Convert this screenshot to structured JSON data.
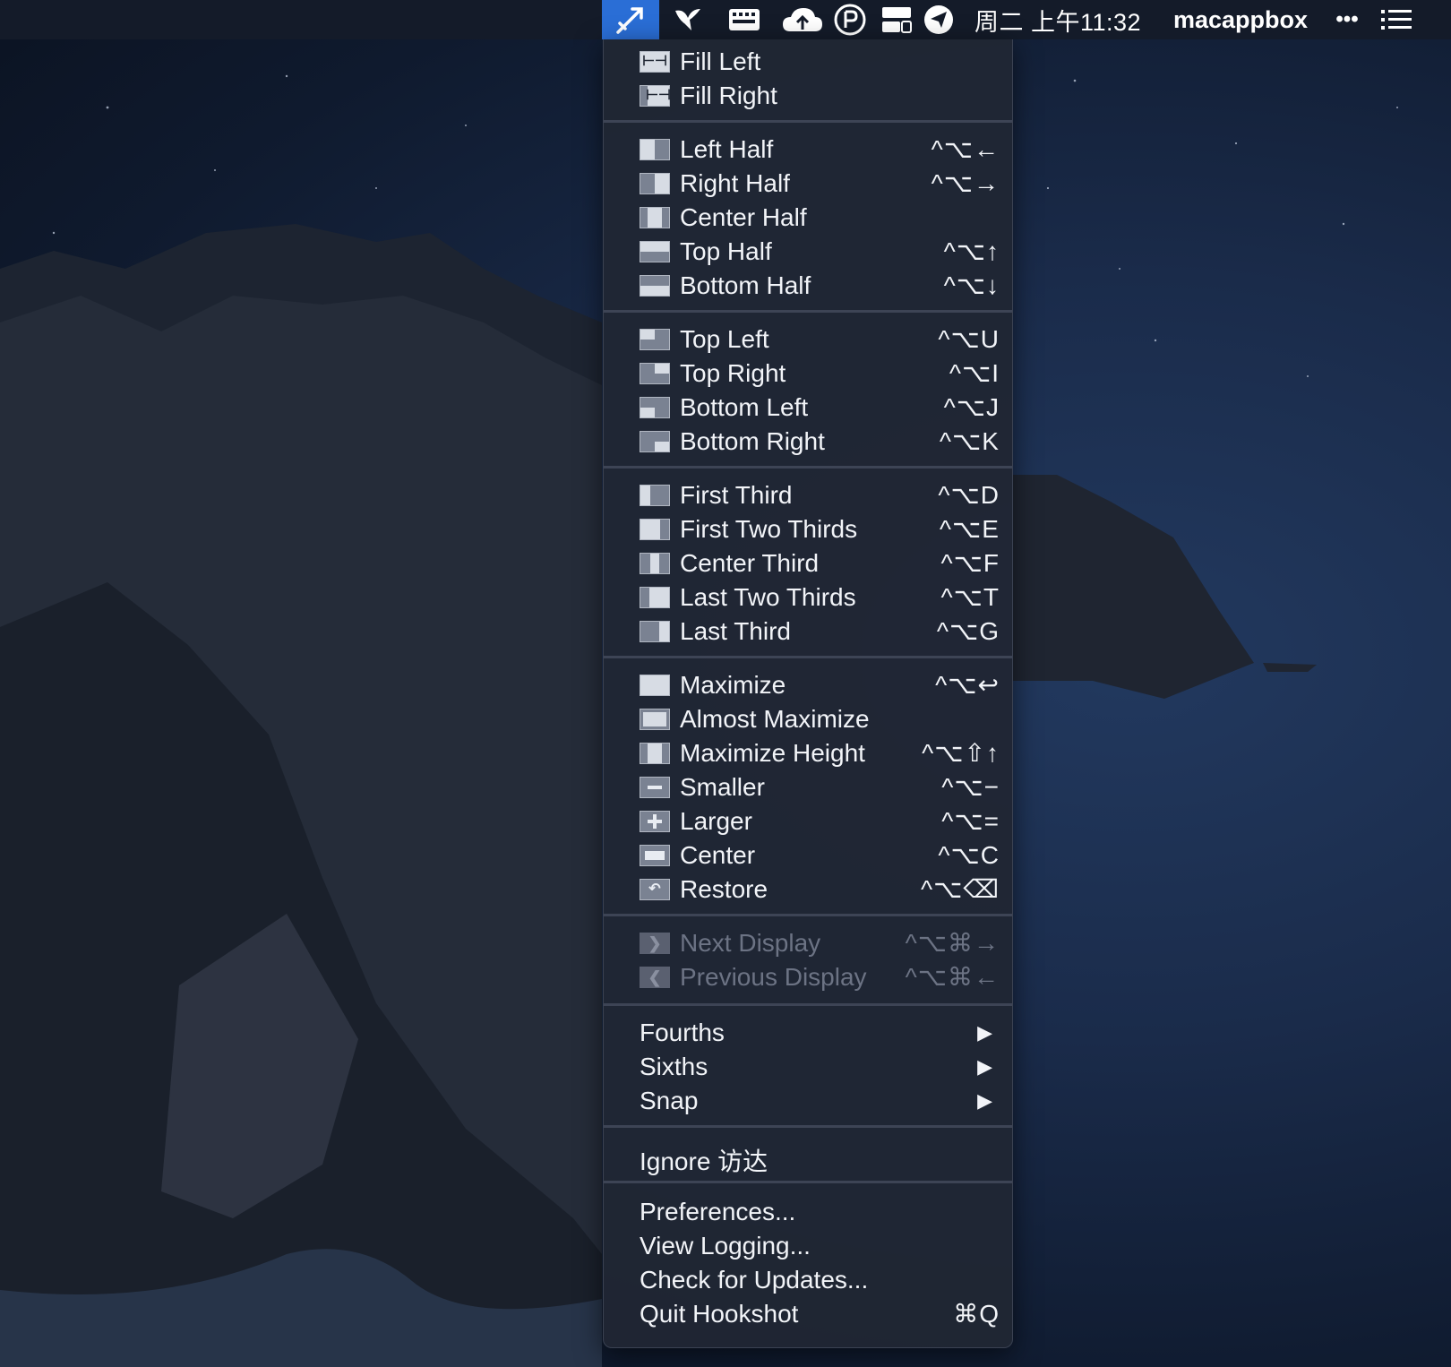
{
  "menubar": {
    "icons": [
      "hookshot-icon",
      "bird-icon",
      "keyboard-icon",
      "cloud-icon",
      "shield-badge-icon",
      "window-layout-icon",
      "paper-plane-icon"
    ],
    "clock": "周二 上午11:32",
    "user": "macappbox",
    "more": "•••",
    "list_icon": "notification-center-icon",
    "highlight_color": "#2a6ed6"
  },
  "menu": {
    "fill": [
      {
        "label": "Fill Left",
        "shortcut": ""
      },
      {
        "label": "Fill Right",
        "shortcut": ""
      }
    ],
    "halves": [
      {
        "label": "Left Half",
        "shortcut": "^⌥←"
      },
      {
        "label": "Right Half",
        "shortcut": "^⌥→"
      },
      {
        "label": "Center Half",
        "shortcut": ""
      },
      {
        "label": "Top Half",
        "shortcut": "^⌥↑"
      },
      {
        "label": "Bottom Half",
        "shortcut": "^⌥↓"
      }
    ],
    "corners": [
      {
        "label": "Top Left",
        "shortcut": "^⌥U"
      },
      {
        "label": "Top Right",
        "shortcut": "^⌥I"
      },
      {
        "label": "Bottom Left",
        "shortcut": "^⌥J"
      },
      {
        "label": "Bottom Right",
        "shortcut": "^⌥K"
      }
    ],
    "thirds": [
      {
        "label": "First Third",
        "shortcut": "^⌥D"
      },
      {
        "label": "First Two Thirds",
        "shortcut": "^⌥E"
      },
      {
        "label": "Center Third",
        "shortcut": "^⌥F"
      },
      {
        "label": "Last Two Thirds",
        "shortcut": "^⌥T"
      },
      {
        "label": "Last Third",
        "shortcut": "^⌥G"
      }
    ],
    "sizing": [
      {
        "label": "Maximize",
        "shortcut": "^⌥↩"
      },
      {
        "label": "Almost Maximize",
        "shortcut": ""
      },
      {
        "label": "Maximize Height",
        "shortcut": "^⌥⇧↑"
      },
      {
        "label": "Smaller",
        "shortcut": "^⌥−"
      },
      {
        "label": "Larger",
        "shortcut": "^⌥="
      },
      {
        "label": "Center",
        "shortcut": "^⌥C"
      },
      {
        "label": "Restore",
        "shortcut": "^⌥⌫"
      }
    ],
    "displays": [
      {
        "label": "Next Display",
        "shortcut": "^⌥⌘→"
      },
      {
        "label": "Previous Display",
        "shortcut": "^⌥⌘←"
      }
    ],
    "submenus": [
      {
        "label": "Fourths",
        "arrow": "▶"
      },
      {
        "label": "Sixths",
        "arrow": "▶"
      },
      {
        "label": "Snap",
        "arrow": "▶"
      }
    ],
    "ignore": {
      "label": "Ignore 访达"
    },
    "app": [
      {
        "label": "Preferences...",
        "shortcut": ""
      },
      {
        "label": "View Logging...",
        "shortcut": ""
      },
      {
        "label": "Check for Updates...",
        "shortcut": ""
      },
      {
        "label": "Quit Hookshot",
        "shortcut": "⌘Q"
      }
    ]
  }
}
